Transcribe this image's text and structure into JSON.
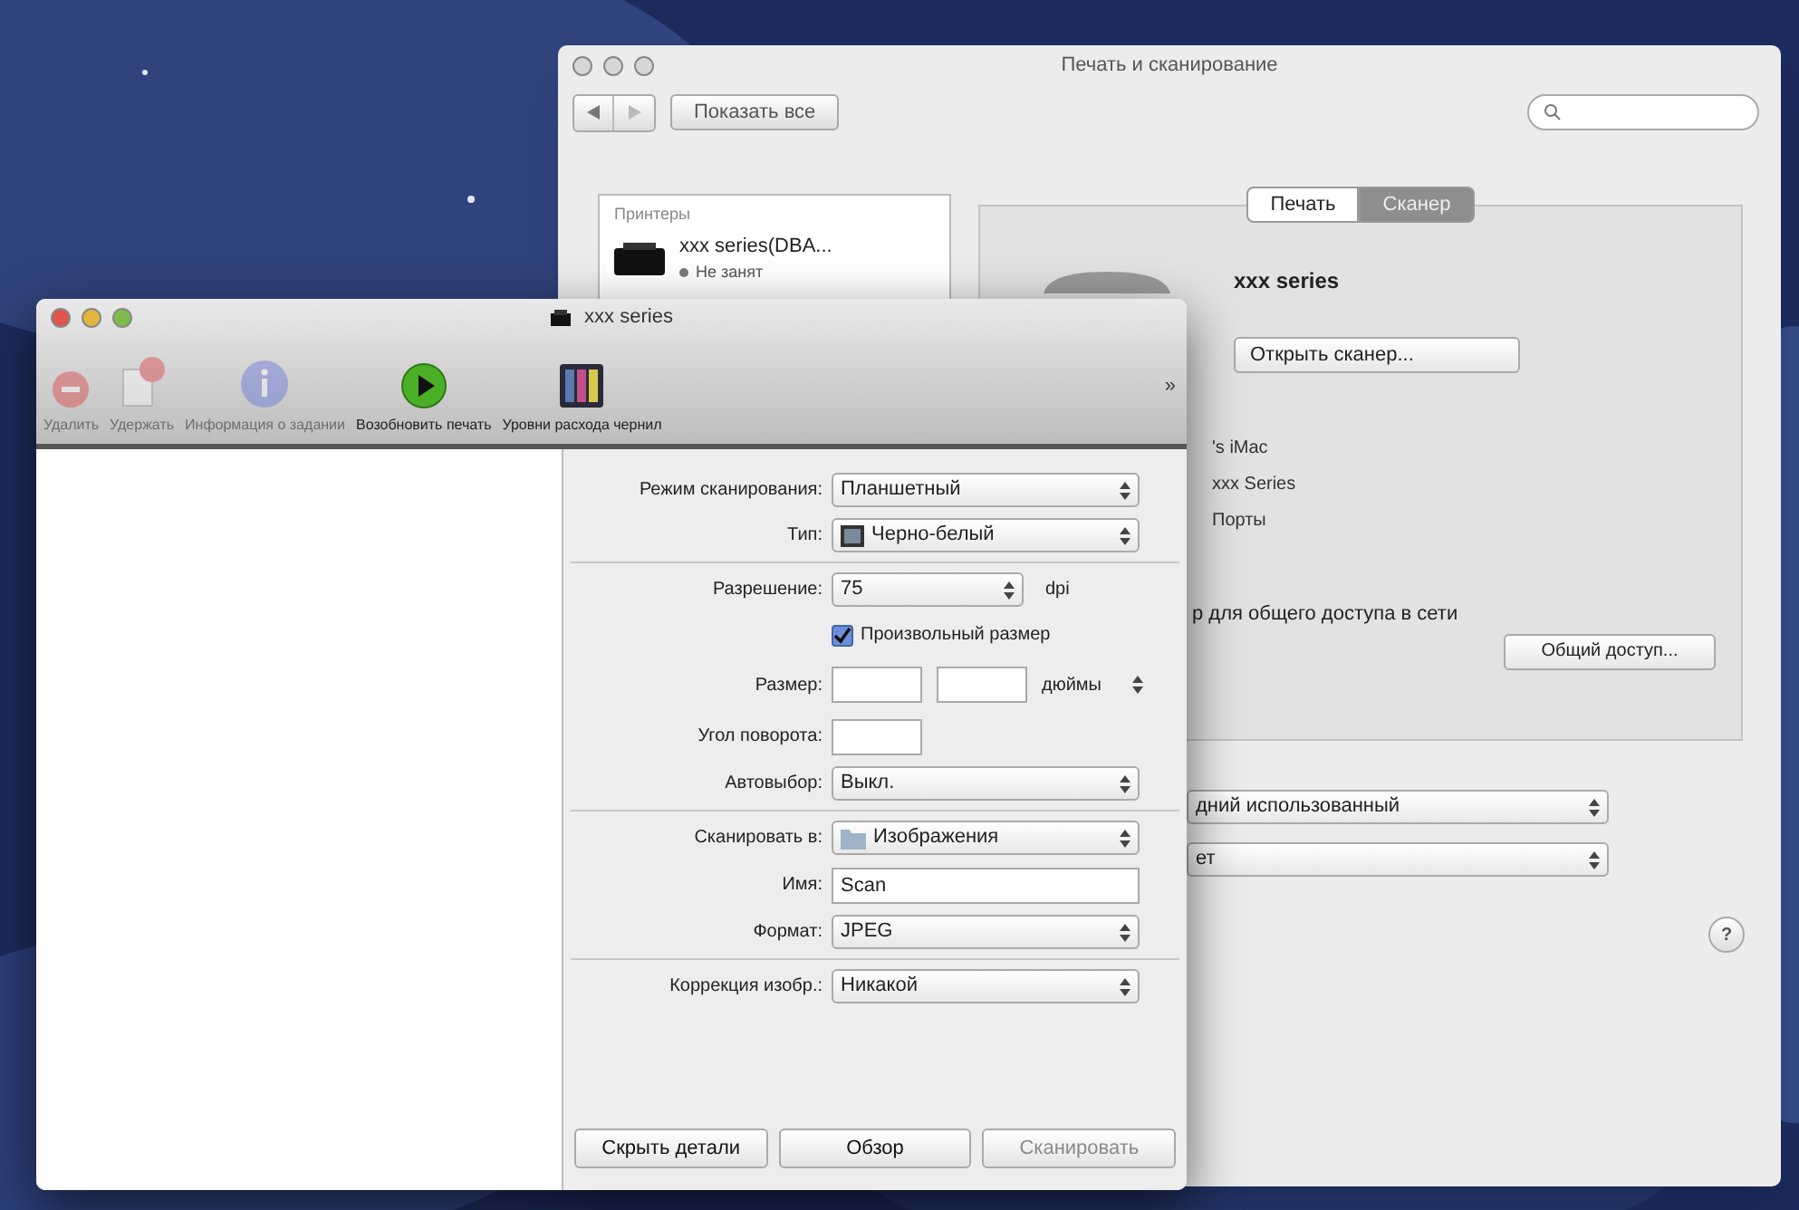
{
  "back_window": {
    "title": "Печать и сканирование",
    "toolbar": {
      "show_all": "Показать все"
    },
    "sidebar": {
      "header": "Принтеры",
      "item": {
        "name": "xxx series(DBA...",
        "status": "Не занят"
      }
    },
    "tabs": [
      {
        "label": "Печать",
        "selected": false
      },
      {
        "label": "Сканер",
        "selected": true
      }
    ],
    "device_name": "xxx series",
    "open_button": "Открыть сканер...",
    "info_lines": [
      "'s iMac",
      "xxx Series",
      "Порты"
    ],
    "share_text": "р для общего доступа в сети",
    "share_button": "Общий доступ...",
    "popups": [
      "дний использованный",
      "ет"
    ],
    "help": "?"
  },
  "front_window": {
    "title": "xxx series",
    "toolbar": [
      {
        "kind": "delete",
        "label": "Удалить",
        "disabled": true
      },
      {
        "kind": "hold",
        "label": "Удержать",
        "disabled": true
      },
      {
        "kind": "info",
        "label": "Информация о задании",
        "disabled": true
      },
      {
        "kind": "resume",
        "label": "Возобновить печать",
        "disabled": false
      },
      {
        "kind": "supply",
        "label": "Уровни расхода чернил",
        "disabled": false
      }
    ],
    "overflow": "»",
    "sections": [
      [
        {
          "kind": "popup",
          "label": "Режим сканирования:",
          "value": "Планшетный"
        },
        {
          "kind": "image-popup",
          "label": "Тип:",
          "value": "Черно-белый"
        }
      ],
      [
        {
          "kind": "short-popup",
          "label": "Разрешение:",
          "value": "75",
          "unit": "dpi"
        },
        {
          "kind": "checkbox",
          "label": "Произвольный размер",
          "checked": true
        },
        {
          "kind": "size",
          "label": "Размер:",
          "unit": "дюймы"
        },
        {
          "kind": "short-field",
          "label": "Угол поворота:"
        },
        {
          "kind": "popup",
          "label": "Автовыбор:",
          "value": "Выкл."
        }
      ],
      [
        {
          "kind": "folder-popup",
          "label": "Сканировать в:",
          "value": "Изображения"
        },
        {
          "kind": "field",
          "label": "Имя:",
          "value": "Scan"
        },
        {
          "kind": "popup",
          "label": "Формат:",
          "value": "JPEG"
        }
      ],
      [
        {
          "kind": "popup",
          "label": "Коррекция изобр.:",
          "value": "Никакой"
        }
      ]
    ],
    "buttons": [
      {
        "label": "Скрыть детали",
        "disabled": false
      },
      {
        "label": "Обзор",
        "disabled": false
      },
      {
        "label": "Сканировать",
        "disabled": true
      }
    ]
  }
}
